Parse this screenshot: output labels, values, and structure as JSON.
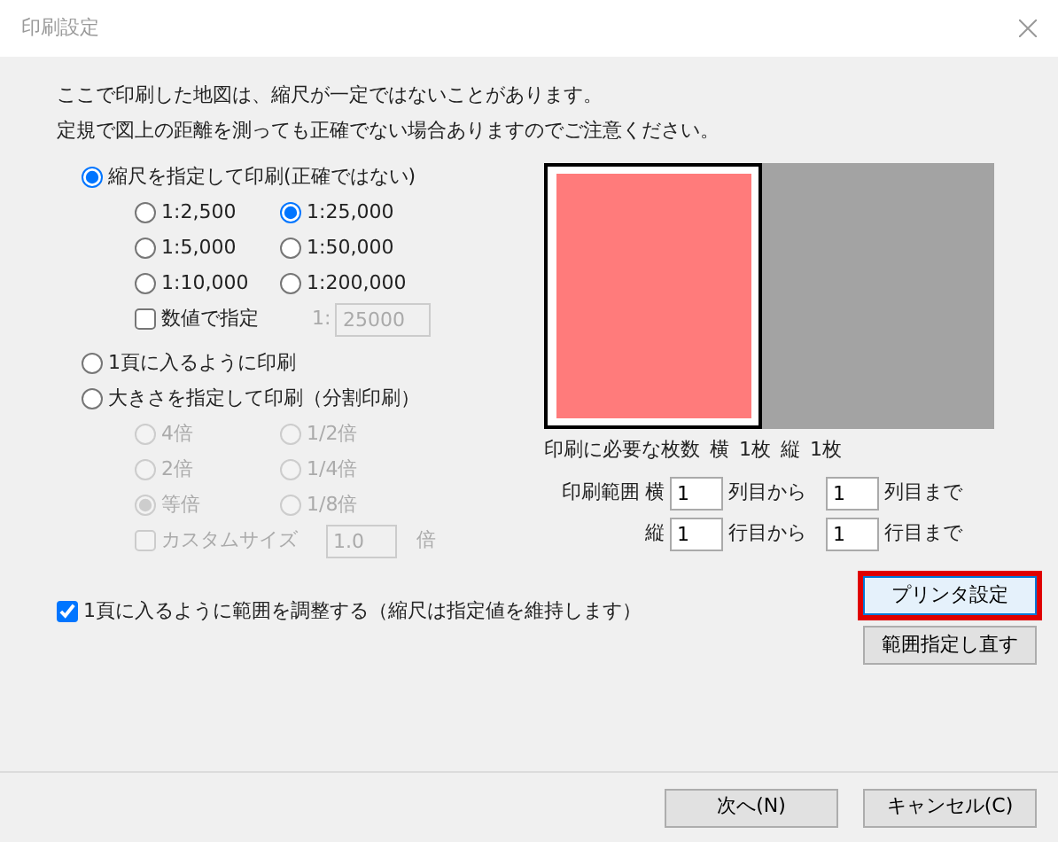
{
  "window": {
    "title": "印刷設定"
  },
  "message": [
    "ここで印刷した地図は、縮尺が一定ではないことがあります。",
    "定規で図上の距離を測っても正確でない場合ありますのでご注意ください。"
  ],
  "scale_mode": {
    "label": "縮尺を指定して印刷(正確ではない)",
    "selected": true,
    "options": [
      {
        "label": "1:2,500",
        "selected": false
      },
      {
        "label": "1:25,000",
        "selected": true
      },
      {
        "label": "1:5,000",
        "selected": false
      },
      {
        "label": "1:50,000",
        "selected": false
      },
      {
        "label": "1:10,000",
        "selected": false
      },
      {
        "label": "1:200,000",
        "selected": false
      }
    ],
    "numeric": {
      "label": "数値で指定",
      "checked": false,
      "prefix": "1:",
      "value": "25000",
      "disabled": true
    }
  },
  "fit_mode": {
    "label": "1頁に入るように印刷",
    "selected": false
  },
  "size_mode": {
    "label": "大きさを指定して印刷（分割印刷）",
    "selected": false,
    "options": [
      {
        "label": "4倍",
        "selected": false,
        "disabled": true
      },
      {
        "label": "1/2倍",
        "selected": false,
        "disabled": true
      },
      {
        "label": "2倍",
        "selected": false,
        "disabled": true
      },
      {
        "label": "1/4倍",
        "selected": false,
        "disabled": true
      },
      {
        "label": "等倍",
        "selected": true,
        "disabled": true
      },
      {
        "label": "1/8倍",
        "selected": false,
        "disabled": true
      }
    ],
    "custom": {
      "label": "カスタムサイズ",
      "checked": false,
      "value": "1.0",
      "unit": "倍",
      "disabled": true
    }
  },
  "sheets": {
    "label": "印刷に必要な枚数",
    "h_label": "横",
    "h_value": "1枚",
    "v_label": "縦",
    "v_value": "1枚"
  },
  "range": {
    "label": "印刷範囲",
    "rows": [
      {
        "axis": "横",
        "from": "1",
        "from_suffix": "列目から",
        "to": "1",
        "to_suffix": "列目まで"
      },
      {
        "axis": "縦",
        "from": "1",
        "from_suffix": "行目から",
        "to": "1",
        "to_suffix": "行目まで"
      }
    ]
  },
  "adjust": {
    "label": "1頁に入るように範囲を調整する（縮尺は指定値を維持します）",
    "checked": true
  },
  "buttons": [
    {
      "label": "プリンタ設定",
      "highlighted": true
    },
    {
      "label": "範囲指定し直す",
      "highlighted": false
    }
  ],
  "footer_buttons": [
    {
      "label": "次へ(N)",
      "disabled": false
    },
    {
      "label": "キャンセル(C)",
      "disabled": false
    }
  ]
}
